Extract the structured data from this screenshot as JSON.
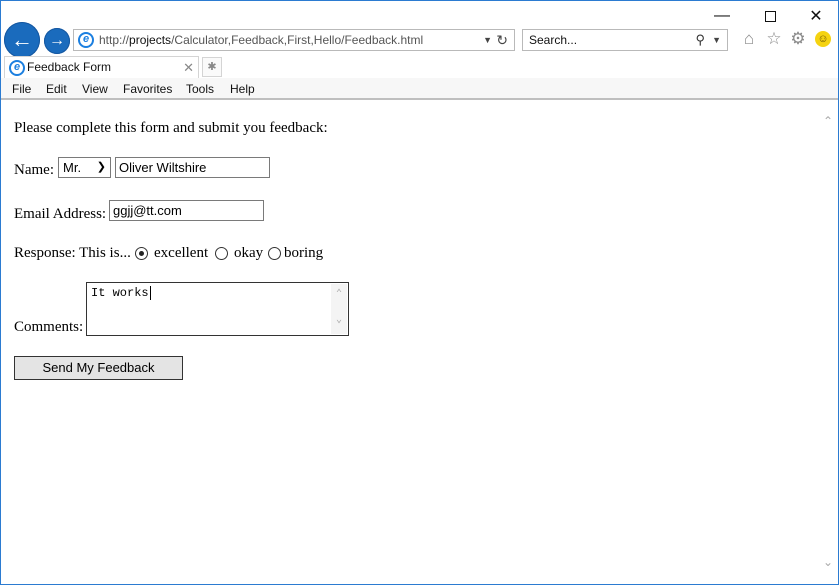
{
  "window": {
    "minimize_icon": "minimize-icon",
    "maximize_icon": "maximize-icon",
    "close_icon": "close-icon"
  },
  "address_bar": {
    "url_prefix": "http://",
    "url_host": "projects",
    "url_path": "/Calculator,Feedback,First,Hello/Feedback.html"
  },
  "search": {
    "placeholder": "Search..."
  },
  "tab": {
    "title": "Feedback Form"
  },
  "menu": [
    "File",
    "Edit",
    "View",
    "Favorites",
    "Tools",
    "Help"
  ],
  "form": {
    "intro": "Please complete this form and submit you feedback:",
    "name_label": "Name:",
    "title_select": "Mr.",
    "name_value": "Oliver Wiltshire",
    "email_label": "Email Address:",
    "email_value": "ggjj@tt.com",
    "response_label": "Response: This is...",
    "responses": [
      {
        "label": "excellent",
        "checked": true
      },
      {
        "label": "okay",
        "checked": false
      },
      {
        "label": "boring",
        "checked": false
      }
    ],
    "comments_label": "Comments:",
    "comments_value": "It works",
    "submit_label": "Send My Feedback"
  },
  "colors": {
    "accent": "#1a6bbd",
    "window_border": "#2b7bd1"
  }
}
